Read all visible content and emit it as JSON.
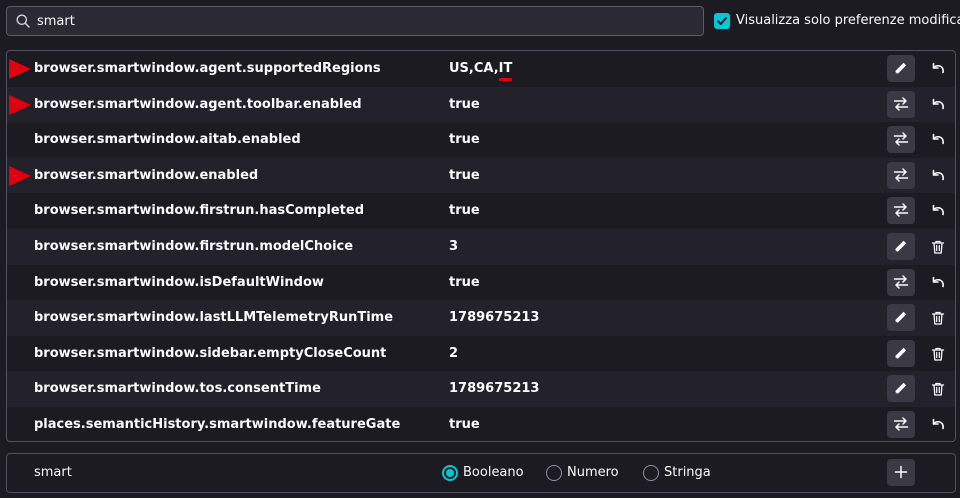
{
  "search": {
    "value": "smart"
  },
  "filter": {
    "label": "Visualizza solo preferenze modificate",
    "checked": true
  },
  "rows": [
    {
      "name": "browser.smartwindow.agent.supportedRegions",
      "value_plain": "US,CA,",
      "value_underlined": "IT",
      "marked": true,
      "action": "edit",
      "secondary": "reset"
    },
    {
      "name": "browser.smartwindow.agent.toolbar.enabled",
      "value_plain": "true",
      "value_underlined": "",
      "marked": true,
      "action": "toggle",
      "secondary": "reset"
    },
    {
      "name": "browser.smartwindow.aitab.enabled",
      "value_plain": "true",
      "value_underlined": "",
      "marked": false,
      "action": "toggle",
      "secondary": "reset"
    },
    {
      "name": "browser.smartwindow.enabled",
      "value_plain": "true",
      "value_underlined": "",
      "marked": true,
      "action": "toggle",
      "secondary": "reset"
    },
    {
      "name": "browser.smartwindow.firstrun.hasCompleted",
      "value_plain": "true",
      "value_underlined": "",
      "marked": false,
      "action": "toggle",
      "secondary": "reset"
    },
    {
      "name": "browser.smartwindow.firstrun.modelChoice",
      "value_plain": "3",
      "value_underlined": "",
      "marked": false,
      "action": "edit",
      "secondary": "delete"
    },
    {
      "name": "browser.smartwindow.isDefaultWindow",
      "value_plain": "true",
      "value_underlined": "",
      "marked": false,
      "action": "toggle",
      "secondary": "reset"
    },
    {
      "name": "browser.smartwindow.lastLLMTelemetryRunTime",
      "value_plain": "1789675213",
      "value_underlined": "",
      "marked": false,
      "action": "edit",
      "secondary": "delete"
    },
    {
      "name": "browser.smartwindow.sidebar.emptyCloseCount",
      "value_plain": "2",
      "value_underlined": "",
      "marked": false,
      "action": "edit",
      "secondary": "delete"
    },
    {
      "name": "browser.smartwindow.tos.consentTime",
      "value_plain": "1789675213",
      "value_underlined": "",
      "marked": false,
      "action": "edit",
      "secondary": "delete"
    },
    {
      "name": "places.semanticHistory.smartwindow.featureGate",
      "value_plain": "true",
      "value_underlined": "",
      "marked": false,
      "action": "toggle",
      "secondary": "reset"
    }
  ],
  "add_row": {
    "name": "smart",
    "types": [
      {
        "label": "Booleano",
        "selected": true
      },
      {
        "label": "Numero",
        "selected": false
      },
      {
        "label": "Stringa",
        "selected": false
      }
    ]
  },
  "colors": {
    "accent": "#00c8d7",
    "marker": "#e0000f",
    "background": "#1c1b22"
  },
  "icons": {
    "search": "search-icon",
    "edit": "pencil-icon",
    "toggle": "toggle-arrows-icon",
    "reset": "reset-arrow-icon",
    "delete": "trash-icon",
    "add": "plus-icon"
  }
}
